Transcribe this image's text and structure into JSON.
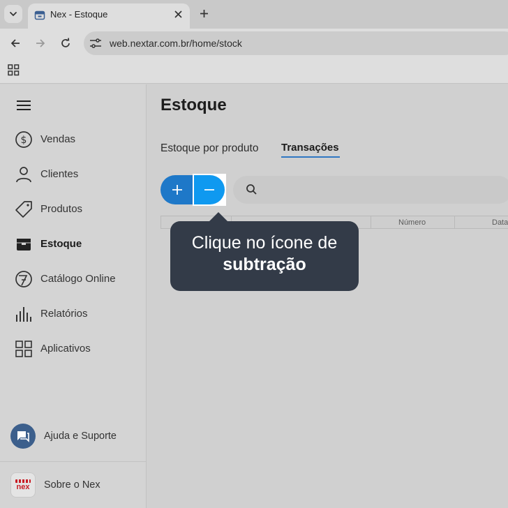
{
  "browser": {
    "tab_title": "Nex - Estoque",
    "url": "web.nextar.com.br/home/stock",
    "icons": [
      "tab-list-icon",
      "favicon-icon",
      "close-icon",
      "plus-icon",
      "back-icon",
      "forward-icon",
      "reload-icon",
      "site-info-icon",
      "apps-grid-icon"
    ]
  },
  "sidebar": {
    "items": [
      {
        "label": "Vendas",
        "icon": "dollar-icon"
      },
      {
        "label": "Clientes",
        "icon": "user-icon"
      },
      {
        "label": "Produtos",
        "icon": "tag-icon"
      },
      {
        "label": "Estoque",
        "icon": "box-icon",
        "active": true
      },
      {
        "label": "Catálogo Online",
        "icon": "catalog-icon"
      },
      {
        "label": "Relatórios",
        "icon": "bar-chart-icon"
      },
      {
        "label": "Aplicativos",
        "icon": "apps-grid-icon"
      }
    ],
    "help_label": "Ajuda e Suporte",
    "about_label": "Sobre o Nex",
    "about_logo_text": "nex"
  },
  "main": {
    "title": "Estoque",
    "tabs": [
      {
        "label": "Estoque por produto",
        "active": false
      },
      {
        "label": "Transações",
        "active": true
      }
    ],
    "table_columns": [
      "Número",
      "Data"
    ]
  },
  "tooltip": {
    "line1": "Clique no ícone de",
    "line2": "subtração"
  },
  "colors": {
    "accent": "#2f77c3",
    "add_button": "#1e78c8",
    "sub_button": "#0f99f0",
    "tooltip_bg": "#333b48"
  }
}
